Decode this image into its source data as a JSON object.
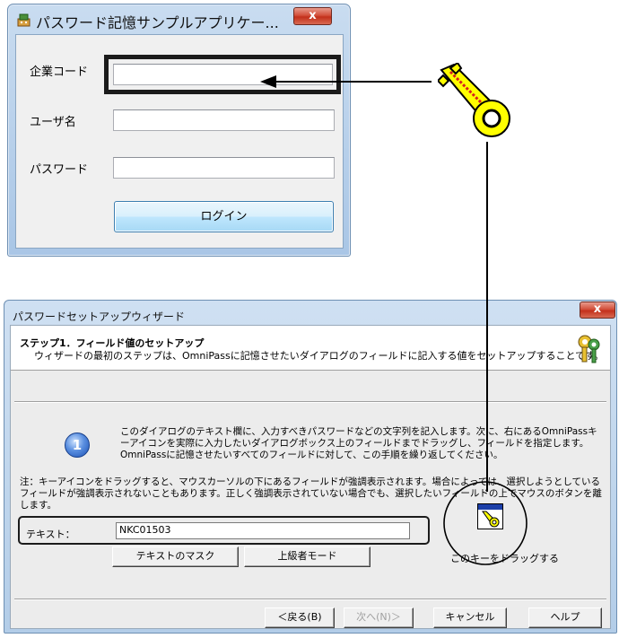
{
  "login_window": {
    "title": "パスワード記憶サンプルアプリケー...",
    "close_label": "x",
    "company_code_label": "企業コード",
    "company_code_value": "",
    "username_label": "ユーザ名",
    "username_value": "",
    "password_label": "パスワード",
    "password_value": "",
    "login_button": "ログイン"
  },
  "wizard": {
    "title": "パスワードセットアップウィザード",
    "close_label": "x",
    "step_title": "ステップ1．フィールド値のセットアップ",
    "step_description": "ウィザードの最初のステップは、OmniPassに記憶させたいダイアログのフィールドに記入する値をセットアップすることです。",
    "info_icon_text": "1",
    "info_text": "このダイアログのテキスト欄に、入力すべきパスワードなどの文字列を記入します。次に、右にあるOmniPassキーアイコンを実際に入力したいダイアログボックス上のフィールドまでドラッグし、フィールドを指定します。OmniPassに記憶させたいすべてのフィールドに対して、この手順を繰り返してください。",
    "note_text": "注：キーアイコンをドラッグすると、マウスカーソルの下にあるフィールドが強調表示されます。場合によっては、選択しようとしているフィールドが強調表示されないこともあります。正しく強調表示されていない場合でも、選択したいフィールドの上でマウスのボタンを離します。",
    "text_label": "テキスト：",
    "text_value": "NKC01503",
    "mask_button": "テキストのマスク",
    "advanced_button": "上級者モード",
    "drag_label": "このキーをドラッグする",
    "back_button": "＜戻る(B)",
    "next_button": "次へ(N)＞",
    "cancel_button": "キャンセル",
    "help_button": "ヘルプ"
  },
  "colors": {
    "key_yellow": "#ffff00",
    "key_red": "#d42020",
    "highlight": "#1b1b1b"
  }
}
